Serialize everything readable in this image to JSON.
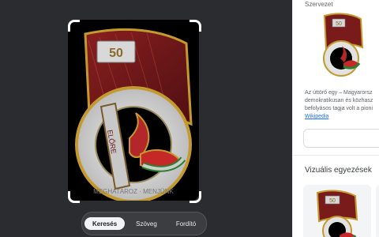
{
  "viewer": {
    "badge_number": "50",
    "badge_banner": "ELŐRE",
    "badge_ring_text": "MEGHATÁROZ · MENJÜNK"
  },
  "modes": [
    {
      "label": "Keresés",
      "active": true
    },
    {
      "label": "Szöveg",
      "active": false
    },
    {
      "label": "Fordító",
      "active": false
    }
  ],
  "side_panel": {
    "section_title": "Szervezet",
    "description_lines": [
      "Az úttörő egy – Magyarorsz",
      "demokratikusan és közhasz",
      "befolyásos tagja volt a pioni"
    ],
    "source_link": "Wikipedia",
    "visual_matches_title": "Vizuális egyezések"
  },
  "colors": {
    "left_bg": "#2b2c2f",
    "badge_red": "#7a1b1b",
    "badge_gold": "#c49a2e",
    "badge_silver": "#d8d8d8"
  }
}
